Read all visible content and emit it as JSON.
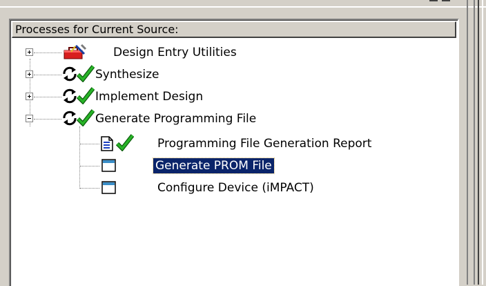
{
  "panel": {
    "header": "Processes for Current Source:"
  },
  "tree": {
    "items": [
      {
        "label": "Design Entry Utilities",
        "icon": "toolbox-icon",
        "expander": "plus"
      },
      {
        "label": "Synthesize",
        "icon": "process-refresh-icon",
        "status": "check-icon",
        "expander": "plus"
      },
      {
        "label": "Implement Design",
        "icon": "process-refresh-icon",
        "status": "check-icon",
        "expander": "plus"
      },
      {
        "label": "Generate Programming File",
        "icon": "process-refresh-icon",
        "status": "check-icon",
        "expander": "minus",
        "children": [
          {
            "label": "Programming File Generation Report",
            "icon": "report-document-icon",
            "status": "check-icon"
          },
          {
            "label": "Generate PROM File",
            "icon": "window-icon",
            "selected": true
          },
          {
            "label": "Configure Device (iMPACT)",
            "icon": "window-icon"
          }
        ]
      }
    ]
  },
  "colors": {
    "selection_bg": "#0a246a",
    "check_green": "#22a022",
    "toolbox_red": "#d81e1e",
    "window_icon_blue": "#3a6ea5"
  }
}
